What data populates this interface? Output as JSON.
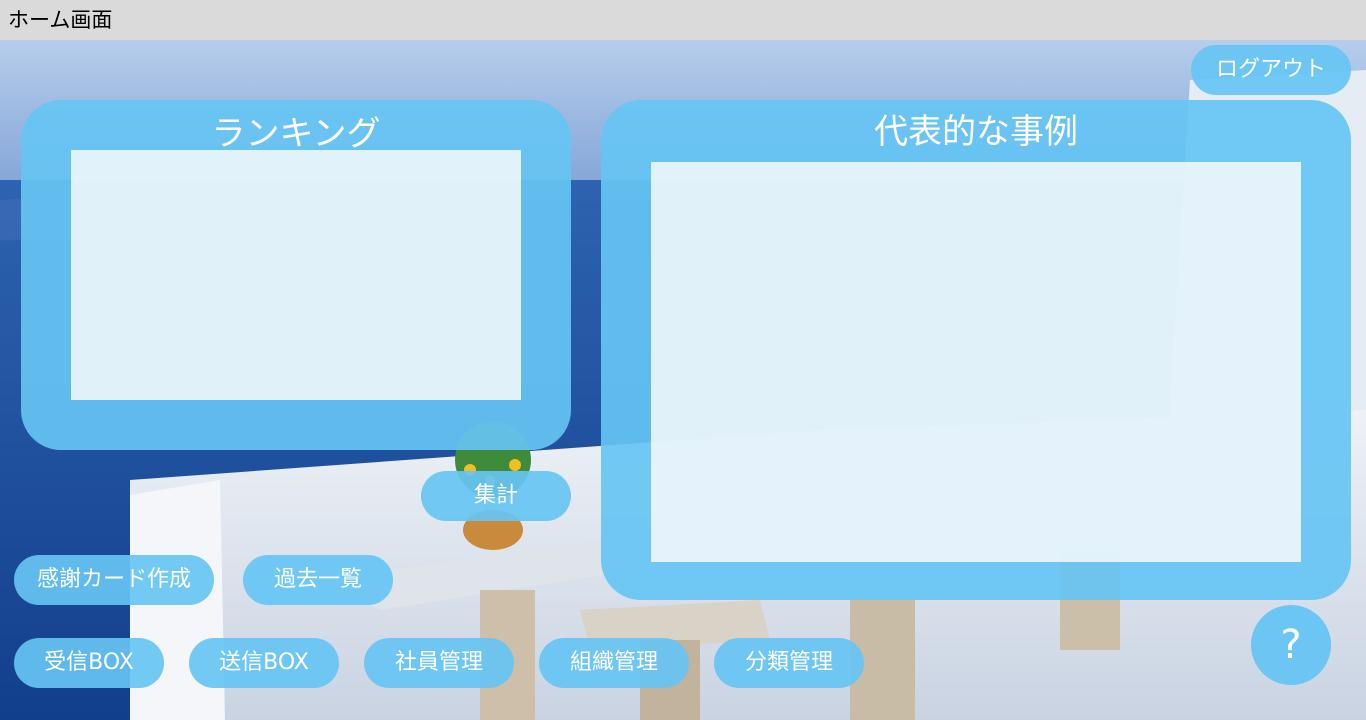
{
  "window": {
    "title": "ホーム画面"
  },
  "header": {
    "logout_label": "ログアウト"
  },
  "ranking_panel": {
    "title": "ランキング"
  },
  "examples_panel": {
    "title": "代表的な事例"
  },
  "buttons": {
    "tally": "集計",
    "create_card": "感謝カード作成",
    "past_list": "過去一覧",
    "inbox": "受信BOX",
    "outbox": "送信BOX",
    "employee_mgmt": "社員管理",
    "org_mgmt": "組織管理",
    "category_mgmt": "分類管理",
    "help": "?"
  },
  "colors": {
    "accent": "#66c4f3",
    "titlebar": "#dadada",
    "panel_inner": "#f6f9fc"
  }
}
